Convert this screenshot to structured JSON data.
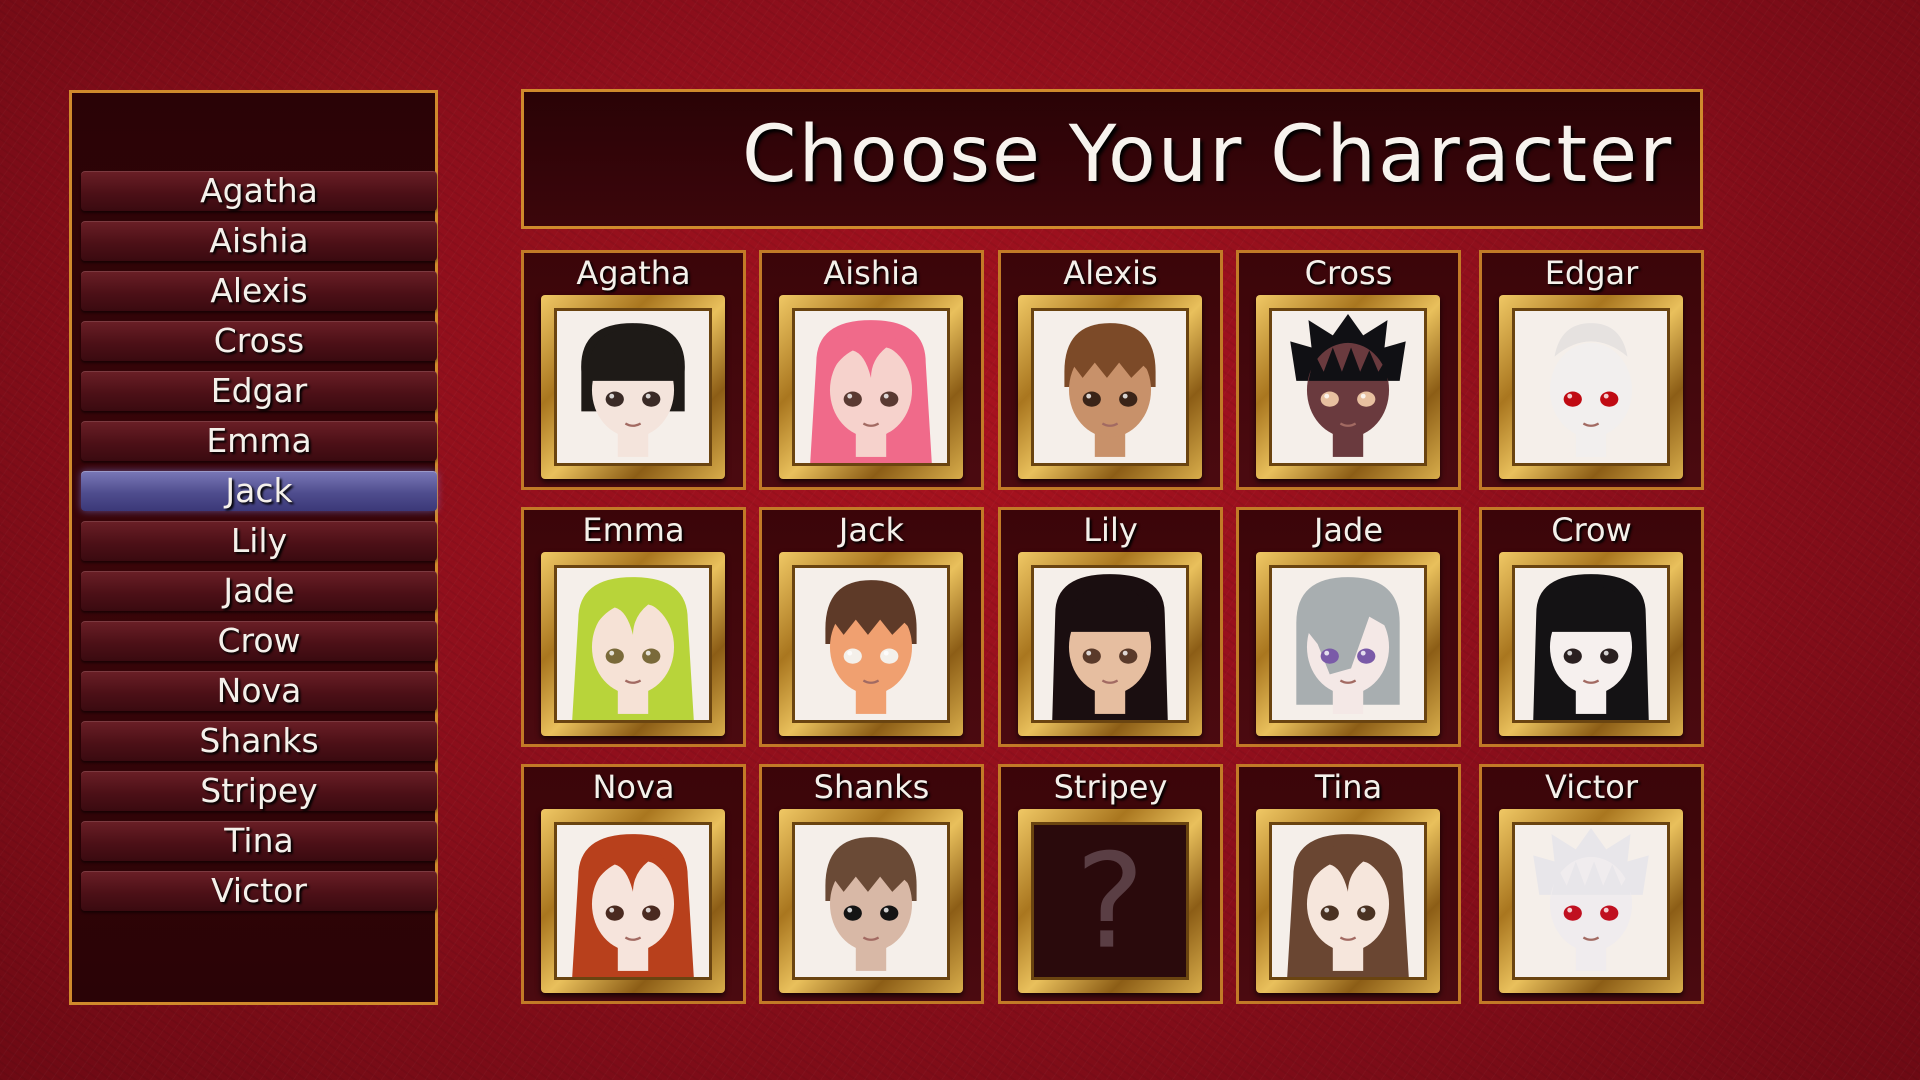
{
  "title": "Choose Your Character",
  "selected_character": "Jack",
  "colors": {
    "background": "#8f0f1c",
    "panel": "#2a0306",
    "border": "#d08a2c",
    "selection": "#5a58a0",
    "text": "#f4f0ea"
  },
  "side_list": [
    "Agatha",
    "Aishia",
    "Alexis",
    "Cross",
    "Edgar",
    "Emma",
    "Jack",
    "Lily",
    "Jade",
    "Crow",
    "Nova",
    "Shanks",
    "Stripey",
    "Tina",
    "Victor"
  ],
  "characters": [
    {
      "name": "Agatha",
      "hair": "#1e1a17",
      "skin": "#f4e4dc",
      "eyes": "#3a2a26",
      "style": "bob"
    },
    {
      "name": "Aishia",
      "hair": "#f06a8a",
      "skin": "#f6d2cc",
      "eyes": "#5a3a32",
      "style": "long"
    },
    {
      "name": "Alexis",
      "hair": "#7c4a28",
      "skin": "#c8916a",
      "eyes": "#3a2418",
      "style": "short"
    },
    {
      "name": "Cross",
      "hair": "#101014",
      "skin": "#6a3a3e",
      "eyes": "#e8c0a0",
      "style": "spiky"
    },
    {
      "name": "Edgar",
      "hair": "#e6e2e0",
      "skin": "#f2efee",
      "eyes": "#c00a12",
      "style": "bald"
    },
    {
      "name": "Emma",
      "hair": "#b8d43a",
      "skin": "#f6e2d6",
      "eyes": "#7a6a3a",
      "style": "long"
    },
    {
      "name": "Jack",
      "hair": "#5e3a28",
      "skin": "#f0a070",
      "eyes": "#f4f0ea",
      "style": "short"
    },
    {
      "name": "Lily",
      "hair": "#1a0e10",
      "skin": "#e6bea0",
      "eyes": "#5a3a2a",
      "style": "hime"
    },
    {
      "name": "Jade",
      "hair": "#a8aeb0",
      "skin": "#f4e8e6",
      "eyes": "#7a5aa8",
      "style": "side"
    },
    {
      "name": "Crow",
      "hair": "#141214",
      "skin": "#f6f0ee",
      "eyes": "#2a2020",
      "style": "hime"
    },
    {
      "name": "Nova",
      "hair": "#b8401c",
      "skin": "#f6e4dc",
      "eyes": "#4a2a20",
      "style": "long"
    },
    {
      "name": "Shanks",
      "hair": "#6a4a36",
      "skin": "#d8b8a6",
      "eyes": "#141414",
      "style": "short"
    },
    {
      "name": "Stripey",
      "mystery": true,
      "symbol": "?"
    },
    {
      "name": "Tina",
      "hair": "#6a4632",
      "skin": "#f6e6dc",
      "eyes": "#4a3222",
      "style": "long"
    },
    {
      "name": "Victor",
      "hair": "#e8e6ea",
      "skin": "#f0ecee",
      "eyes": "#c01020",
      "style": "spiky"
    }
  ]
}
